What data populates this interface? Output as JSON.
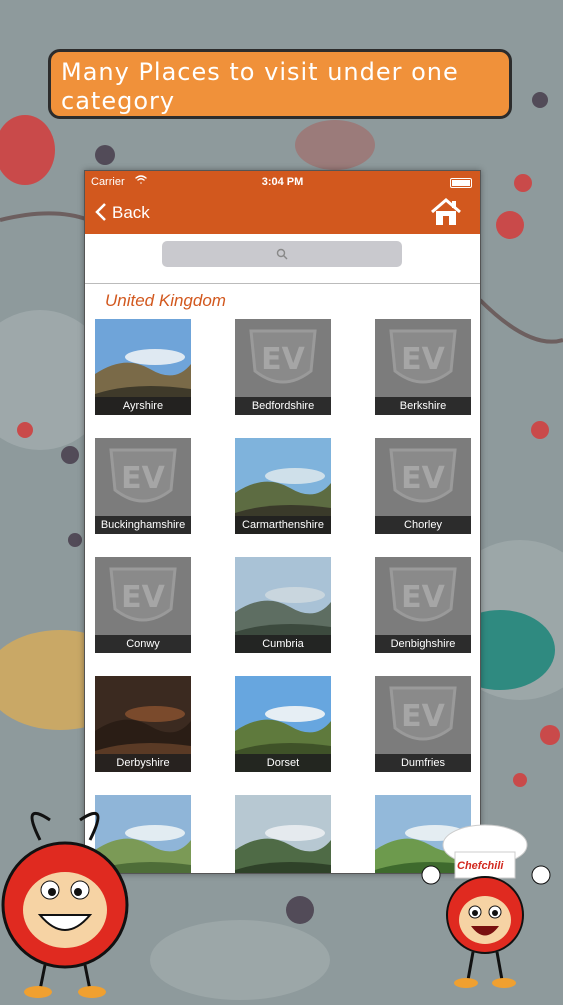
{
  "banner": {
    "text": "Many Places to visit under one category"
  },
  "status_bar": {
    "carrier": "Carrier",
    "time": "3:04 PM"
  },
  "nav": {
    "back_label": "Back"
  },
  "search": {
    "placeholder": ""
  },
  "section_title": "United Kingdom",
  "places": [
    {
      "name": "Ayrshire",
      "img": "photo-hills"
    },
    {
      "name": "Bedfordshire",
      "img": "ev-logo"
    },
    {
      "name": "Berkshire",
      "img": "ev-logo"
    },
    {
      "name": "Buckinghamshire",
      "img": "ev-logo"
    },
    {
      "name": "Carmarthenshire",
      "img": "photo-valley"
    },
    {
      "name": "Chorley",
      "img": "ev-logo"
    },
    {
      "name": "Conwy",
      "img": "ev-logo"
    },
    {
      "name": "Cumbria",
      "img": "photo-mountains"
    },
    {
      "name": "Denbighshire",
      "img": "ev-logo"
    },
    {
      "name": "Derbyshire",
      "img": "photo-cave"
    },
    {
      "name": "Dorset",
      "img": "photo-coast"
    },
    {
      "name": "Dumfries",
      "img": "ev-logo"
    },
    {
      "name": "",
      "img": "photo-moor"
    },
    {
      "name": "",
      "img": "photo-forest"
    },
    {
      "name": "",
      "img": "photo-green"
    }
  ],
  "chef_logo_text": "Chefchili",
  "colors": {
    "accent": "#d2581e",
    "banner": "#f0913a"
  }
}
